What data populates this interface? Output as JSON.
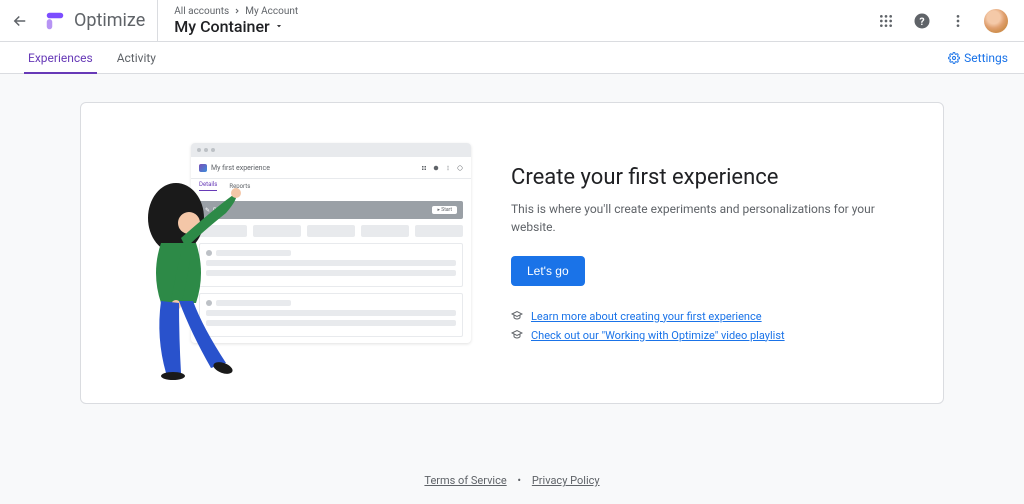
{
  "header": {
    "product": "Optimize",
    "breadcrumb": {
      "root": "All accounts",
      "account": "My Account"
    },
    "container": "My Container"
  },
  "tabs": {
    "experiences": "Experiences",
    "activity": "Activity",
    "settings": "Settings"
  },
  "hero": {
    "title": "Create your first experience",
    "subtitle": "This is where you'll create experiments and personalizations for your website.",
    "cta": "Let's go",
    "link1": "Learn more about creating your first experience",
    "link2": "Check out our \"Working with Optimize\" video playlist"
  },
  "mock": {
    "title": "My first experience",
    "tab1": "Details",
    "tab2": "Reports",
    "draft": "Draft",
    "start": "Start"
  },
  "footer": {
    "terms": "Terms of Service",
    "privacy": "Privacy Policy"
  }
}
